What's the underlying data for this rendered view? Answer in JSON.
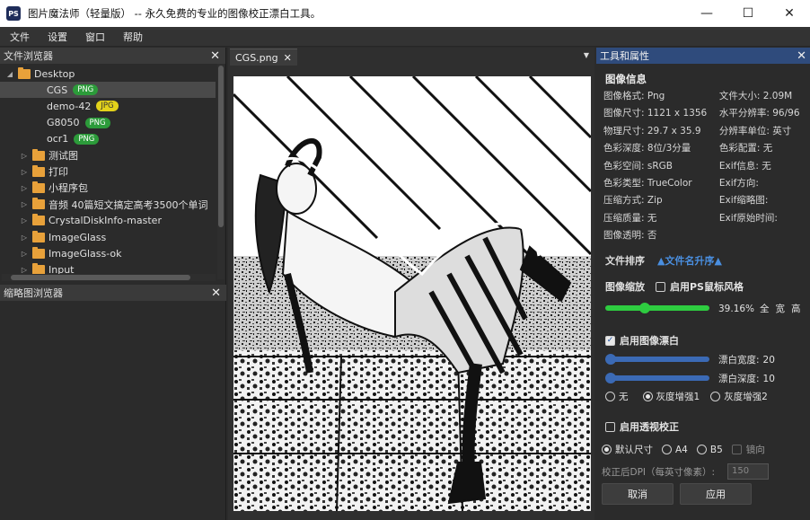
{
  "window": {
    "app_icon_text": "PS",
    "title": "图片魔法师（轻量版） --  永久免费的专业的图像校正漂白工具。",
    "controls": [
      "—",
      "☐",
      "✕"
    ]
  },
  "menu": [
    "文件",
    "设置",
    "窗口",
    "帮助"
  ],
  "file_browser": {
    "title": "文件浏览器",
    "close": "✕",
    "items": [
      {
        "label": "Desktop",
        "level": 0,
        "arrow": "◢",
        "folder": true
      },
      {
        "label": "CGS",
        "level": 1,
        "badge": "PNG",
        "badge_type": "png",
        "selected": true
      },
      {
        "label": "demo-42",
        "level": 1,
        "badge": "JPG",
        "badge_type": "jpg"
      },
      {
        "label": "G8050",
        "level": 1,
        "badge": "PNG",
        "badge_type": "png"
      },
      {
        "label": "ocr1",
        "level": 1,
        "badge": "PNG",
        "badge_type": "png"
      },
      {
        "label": "测试图",
        "level": 1,
        "arrow": "▷",
        "folder": true
      },
      {
        "label": "打印",
        "level": 1,
        "arrow": "▷",
        "folder": true
      },
      {
        "label": "小程序包",
        "level": 1,
        "arrow": "▷",
        "folder": true
      },
      {
        "label": "音频 40篇短文搞定高考3500个单词",
        "level": 1,
        "arrow": "▷",
        "folder": true
      },
      {
        "label": "CrystalDiskInfo-master",
        "level": 1,
        "arrow": "▷",
        "folder": true
      },
      {
        "label": "ImageGlass",
        "level": 1,
        "arrow": "▷",
        "folder": true
      },
      {
        "label": "ImageGlass-ok",
        "level": 1,
        "arrow": "▷",
        "folder": true
      },
      {
        "label": "Input",
        "level": 1,
        "arrow": "▷",
        "folder": true
      }
    ]
  },
  "thumb_browser": {
    "title": "缩略图浏览器",
    "close": "✕"
  },
  "document_tab": {
    "label": "CGS.png",
    "close": "✕",
    "dropdown": "▼"
  },
  "props_panel": {
    "title": "工具和属性",
    "close": "✕",
    "info_title": "图像信息",
    "info_rows": [
      [
        "图像格式: Png",
        "文件大小: 2.09M"
      ],
      [
        "图像尺寸: 1121 x 1356",
        "水平分辨率: 96/96"
      ],
      [
        "物理尺寸: 29.7 x 35.9",
        "分辨率单位: 英寸"
      ],
      [
        "色彩深度: 8位/3分量",
        "色彩配置: 无"
      ],
      [
        "色彩空间: sRGB",
        "Exif信息: 无"
      ],
      [
        "色彩类型: TrueColor",
        "Exif方向:"
      ],
      [
        "压缩方式: Zip",
        "Exif缩略图:"
      ],
      [
        "压缩质量: 无",
        "Exif原始时间:"
      ],
      [
        "图像透明: 否",
        ""
      ]
    ],
    "sort_label": "文件排序",
    "sort_value": "▲文件名升序▲",
    "zoom_label": "图像缩放",
    "ps_wheel_label": "启用PS鼠标风格",
    "zoom_value": "39.16%",
    "zoom_fraction": 0.38,
    "zoom_buttons": [
      "全",
      "宽",
      "高"
    ],
    "bleach_label": "启用图像漂白",
    "bleach_width_label": "漂白宽度:",
    "bleach_width_value": "20",
    "bleach_width_fraction": 0.0,
    "bleach_depth_label": "漂白深度:",
    "bleach_depth_value": "10",
    "bleach_depth_fraction": 0.0,
    "mode_options": [
      "无",
      "灰度增强1",
      "灰度增强2"
    ],
    "mode_selected": 1,
    "perspective_label": "启用透视校正",
    "size_options": [
      "默认尺寸",
      "A4",
      "B5"
    ],
    "size_selected": 0,
    "mirror_label": "镜向",
    "dpi_label": "校正后DPI（每英寸像素）:",
    "dpi_placeholder": "150",
    "cancel_label": "取消",
    "apply_label": "应用"
  },
  "colors": {
    "accent_blue": "#2f4b7c",
    "slider_green": "#2ecc40",
    "slider_blue": "#3b6ab5"
  }
}
